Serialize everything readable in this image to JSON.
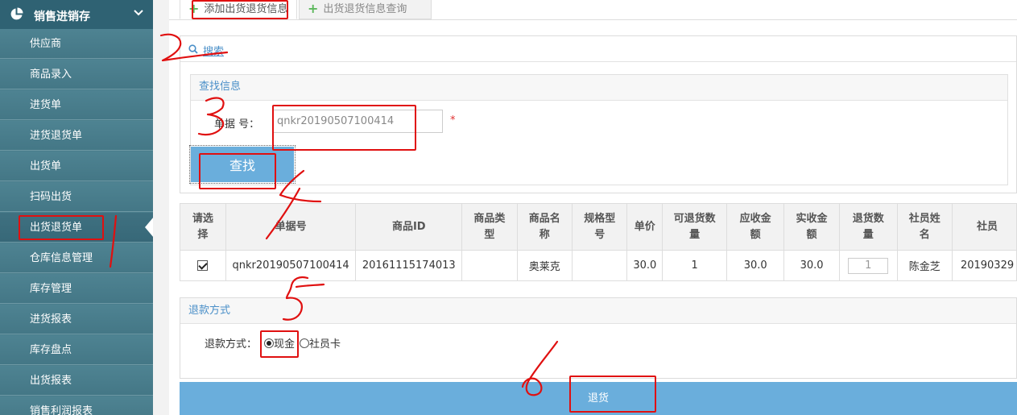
{
  "sidebar": {
    "title": "销售进销存",
    "items": [
      {
        "label": "供应商"
      },
      {
        "label": "商品录入"
      },
      {
        "label": "进货单"
      },
      {
        "label": "进货退货单"
      },
      {
        "label": "出货单"
      },
      {
        "label": "扫码出货"
      },
      {
        "label": "出货退货单"
      },
      {
        "label": "仓库信息管理"
      },
      {
        "label": "库存管理"
      },
      {
        "label": "进货报表"
      },
      {
        "label": "库存盘点"
      },
      {
        "label": "出货报表"
      },
      {
        "label": "销售利润报表"
      }
    ]
  },
  "tabs": [
    {
      "label": "添加出货退货信息"
    },
    {
      "label": "出货退货信息查询"
    }
  ],
  "search": {
    "link_label": "搜索",
    "panel_title": "查找信息",
    "doc_label": "单据 号：",
    "doc_value": "qnkr20190507100414",
    "required_mark": "*",
    "find_button": "查找"
  },
  "table": {
    "headers": [
      "请选\n择",
      "单据号",
      "商品ID",
      "商品类\n型",
      "商品名\n称",
      "规格型\n号",
      "单价",
      "可退货数\n量",
      "应收金\n额",
      "实收金\n额",
      "退货数\n量",
      "社员姓\n名",
      "社员"
    ],
    "rows": [
      {
        "checked": true,
        "doc_no": "qnkr20190507100414",
        "product_id": "20161115174013",
        "product_type": "",
        "product_name": "奥莱克",
        "spec": "",
        "price": "30.0",
        "returnable_qty": "1",
        "receivable": "30.0",
        "received": "30.0",
        "return_qty": "1",
        "member_name": "陈金芝",
        "member_extra": "20190329"
      }
    ]
  },
  "refund": {
    "panel_title": "退款方式",
    "label": "退款方式：",
    "options": [
      {
        "label": "现金",
        "selected": true
      },
      {
        "label": "社员卡",
        "selected": false
      }
    ]
  },
  "submit_label": "退货",
  "colors": {
    "sidebar_bg": "#4a7e8c",
    "sidebar_header": "#2f6273",
    "accent_blue": "#6aaedc",
    "panel_title_blue": "#4a8fc8",
    "annotation_red": "#e01010"
  }
}
